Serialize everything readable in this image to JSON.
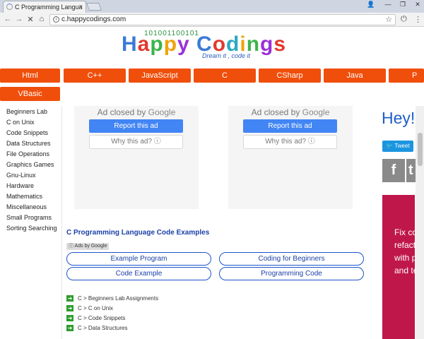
{
  "browser": {
    "tab_title": "C Programming Langua",
    "tab_close": "×",
    "url": "c.happycodings.com",
    "back_icon": "←",
    "forward_icon": "→",
    "reload_icon": "✕",
    "home_icon": "⌂",
    "star_icon": "☆",
    "ext_icon": "⏻",
    "menu_icon": "⋮",
    "win_person": "👤",
    "win_min": "—",
    "win_max": "❐",
    "win_close": "✕"
  },
  "header": {
    "binary": "101001100101",
    "logo_letters": [
      "H",
      "a",
      "p",
      "p",
      "y",
      " ",
      "C",
      "o",
      "d",
      "i",
      "n",
      "g",
      "s"
    ],
    "logo_colors": [
      "#3a7bd5",
      "#e03a2f",
      "#3cb44b",
      "#f0a30a",
      "#9b30d9",
      "#ffffff",
      "#3a7bd5",
      "#e03a2f",
      "#2aa8c4",
      "#f0a30a",
      "#3cb44b",
      "#9b30d9",
      "#e03a2f"
    ],
    "tagline": "Dream it , code it"
  },
  "menu": {
    "row1": [
      "Html",
      "C++",
      "JavaScript",
      "C",
      "CSharp",
      "Java",
      "P"
    ],
    "row2": [
      "VBasic"
    ]
  },
  "sidebar": {
    "items": [
      "Beginners Lab",
      "C on Unix",
      "Code Snippets",
      "Data Structures",
      "File Operations",
      "Graphics Games",
      "Gnu-Linux",
      "Hardware",
      "Mathematics",
      "Miscellaneous",
      "Small Programs",
      "Sorting Searching"
    ]
  },
  "ads": {
    "closed_prefix": "Ad closed by",
    "closed_brand": "Google",
    "report": "Report this ad",
    "why": "Why this ad? ⓘ"
  },
  "main": {
    "section_title": "C Programming Language Code Examples",
    "ads_by": "ⓘ Ads by Google",
    "pills": [
      "Example Program",
      "Coding for Beginners",
      "Code Example",
      "Programming Code"
    ],
    "links": [
      "C > Beginners Lab Assignments",
      "C > C on Unix",
      "C > Code Snippets",
      "C > Data Structures"
    ]
  },
  "right": {
    "hey": "Hey!",
    "tweet": "🐦 Tweet",
    "facebook": "f",
    "twitter": "t",
    "promo_lines": [
      "Fix co",
      "refact",
      "with p",
      "and te"
    ]
  },
  "colors": {
    "menu": "#f04e0b",
    "link_blue": "#1a3fa8",
    "promo": "#c0174b"
  }
}
